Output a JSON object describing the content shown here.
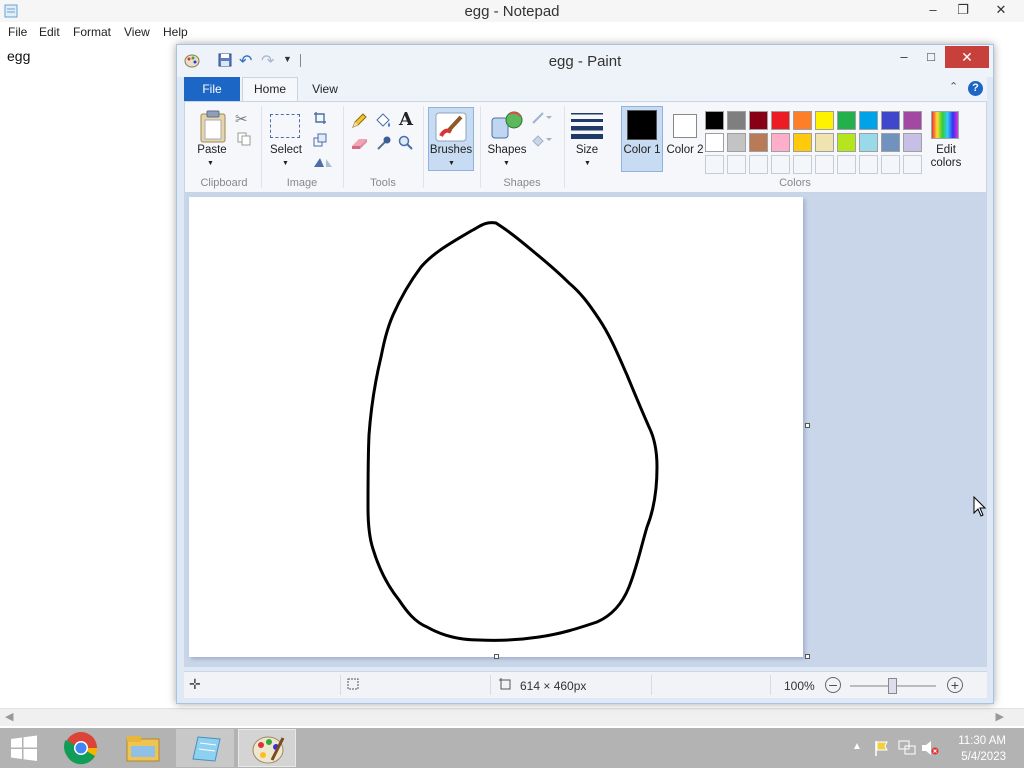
{
  "notepad": {
    "title": "egg - Notepad",
    "menu": [
      "File",
      "Edit",
      "Format",
      "View",
      "Help"
    ],
    "content": "egg"
  },
  "paint": {
    "title": "egg - Paint",
    "tabs": [
      "File",
      "Home",
      "View"
    ],
    "ribbon": {
      "clipboard": {
        "paste": "Paste",
        "group": "Clipboard"
      },
      "image": {
        "select": "Select",
        "group": "Image"
      },
      "tools": {
        "group": "Tools"
      },
      "brushes": "Brushes",
      "shapes": {
        "label": "Shapes",
        "group": "Shapes"
      },
      "size": "Size",
      "color1": "Color 1",
      "color2": "Color 2",
      "colors_group": "Colors",
      "edit_colors": "Edit colors",
      "palette_row1": [
        "#000000",
        "#7f7f7f",
        "#880015",
        "#ed1c24",
        "#ff7f27",
        "#fff200",
        "#22b14c",
        "#00a2e8",
        "#3f48cc",
        "#a349a4"
      ],
      "palette_row2": [
        "#ffffff",
        "#c3c3c3",
        "#b97a57",
        "#ffaec9",
        "#ffc90e",
        "#efe4b0",
        "#b5e61d",
        "#99d9ea",
        "#7092be",
        "#c8bfe7"
      ],
      "palette_row3_empty": 10,
      "color1_value": "#000000",
      "color2_value": "#ffffff"
    },
    "status": {
      "dimensions": "614 × 460px",
      "zoom": "100%"
    }
  },
  "taskbar": {
    "time": "11:30 AM",
    "date": "5/4/2023",
    "apps": [
      "start-icon",
      "chrome-icon",
      "file-explorer-icon",
      "notepad-icon",
      "paint-icon"
    ]
  }
}
